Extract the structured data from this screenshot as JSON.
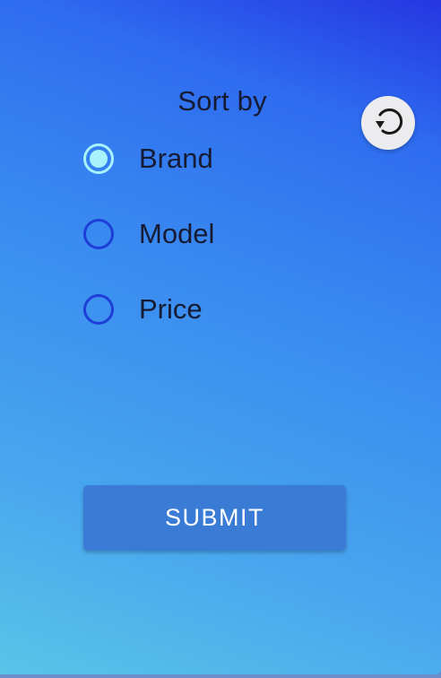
{
  "sort": {
    "title": "Sort by",
    "options": [
      {
        "label": "Brand",
        "checked": true
      },
      {
        "label": "Model",
        "checked": false
      },
      {
        "label": "Price",
        "checked": false
      }
    ]
  },
  "actions": {
    "reset_icon": "reset-icon",
    "submit_label": "SUBMIT"
  },
  "colors": {
    "radio_checked": "#a8f3fb",
    "radio_unchecked": "#1d3fd8",
    "submit_bg": "#3a7bd6"
  }
}
